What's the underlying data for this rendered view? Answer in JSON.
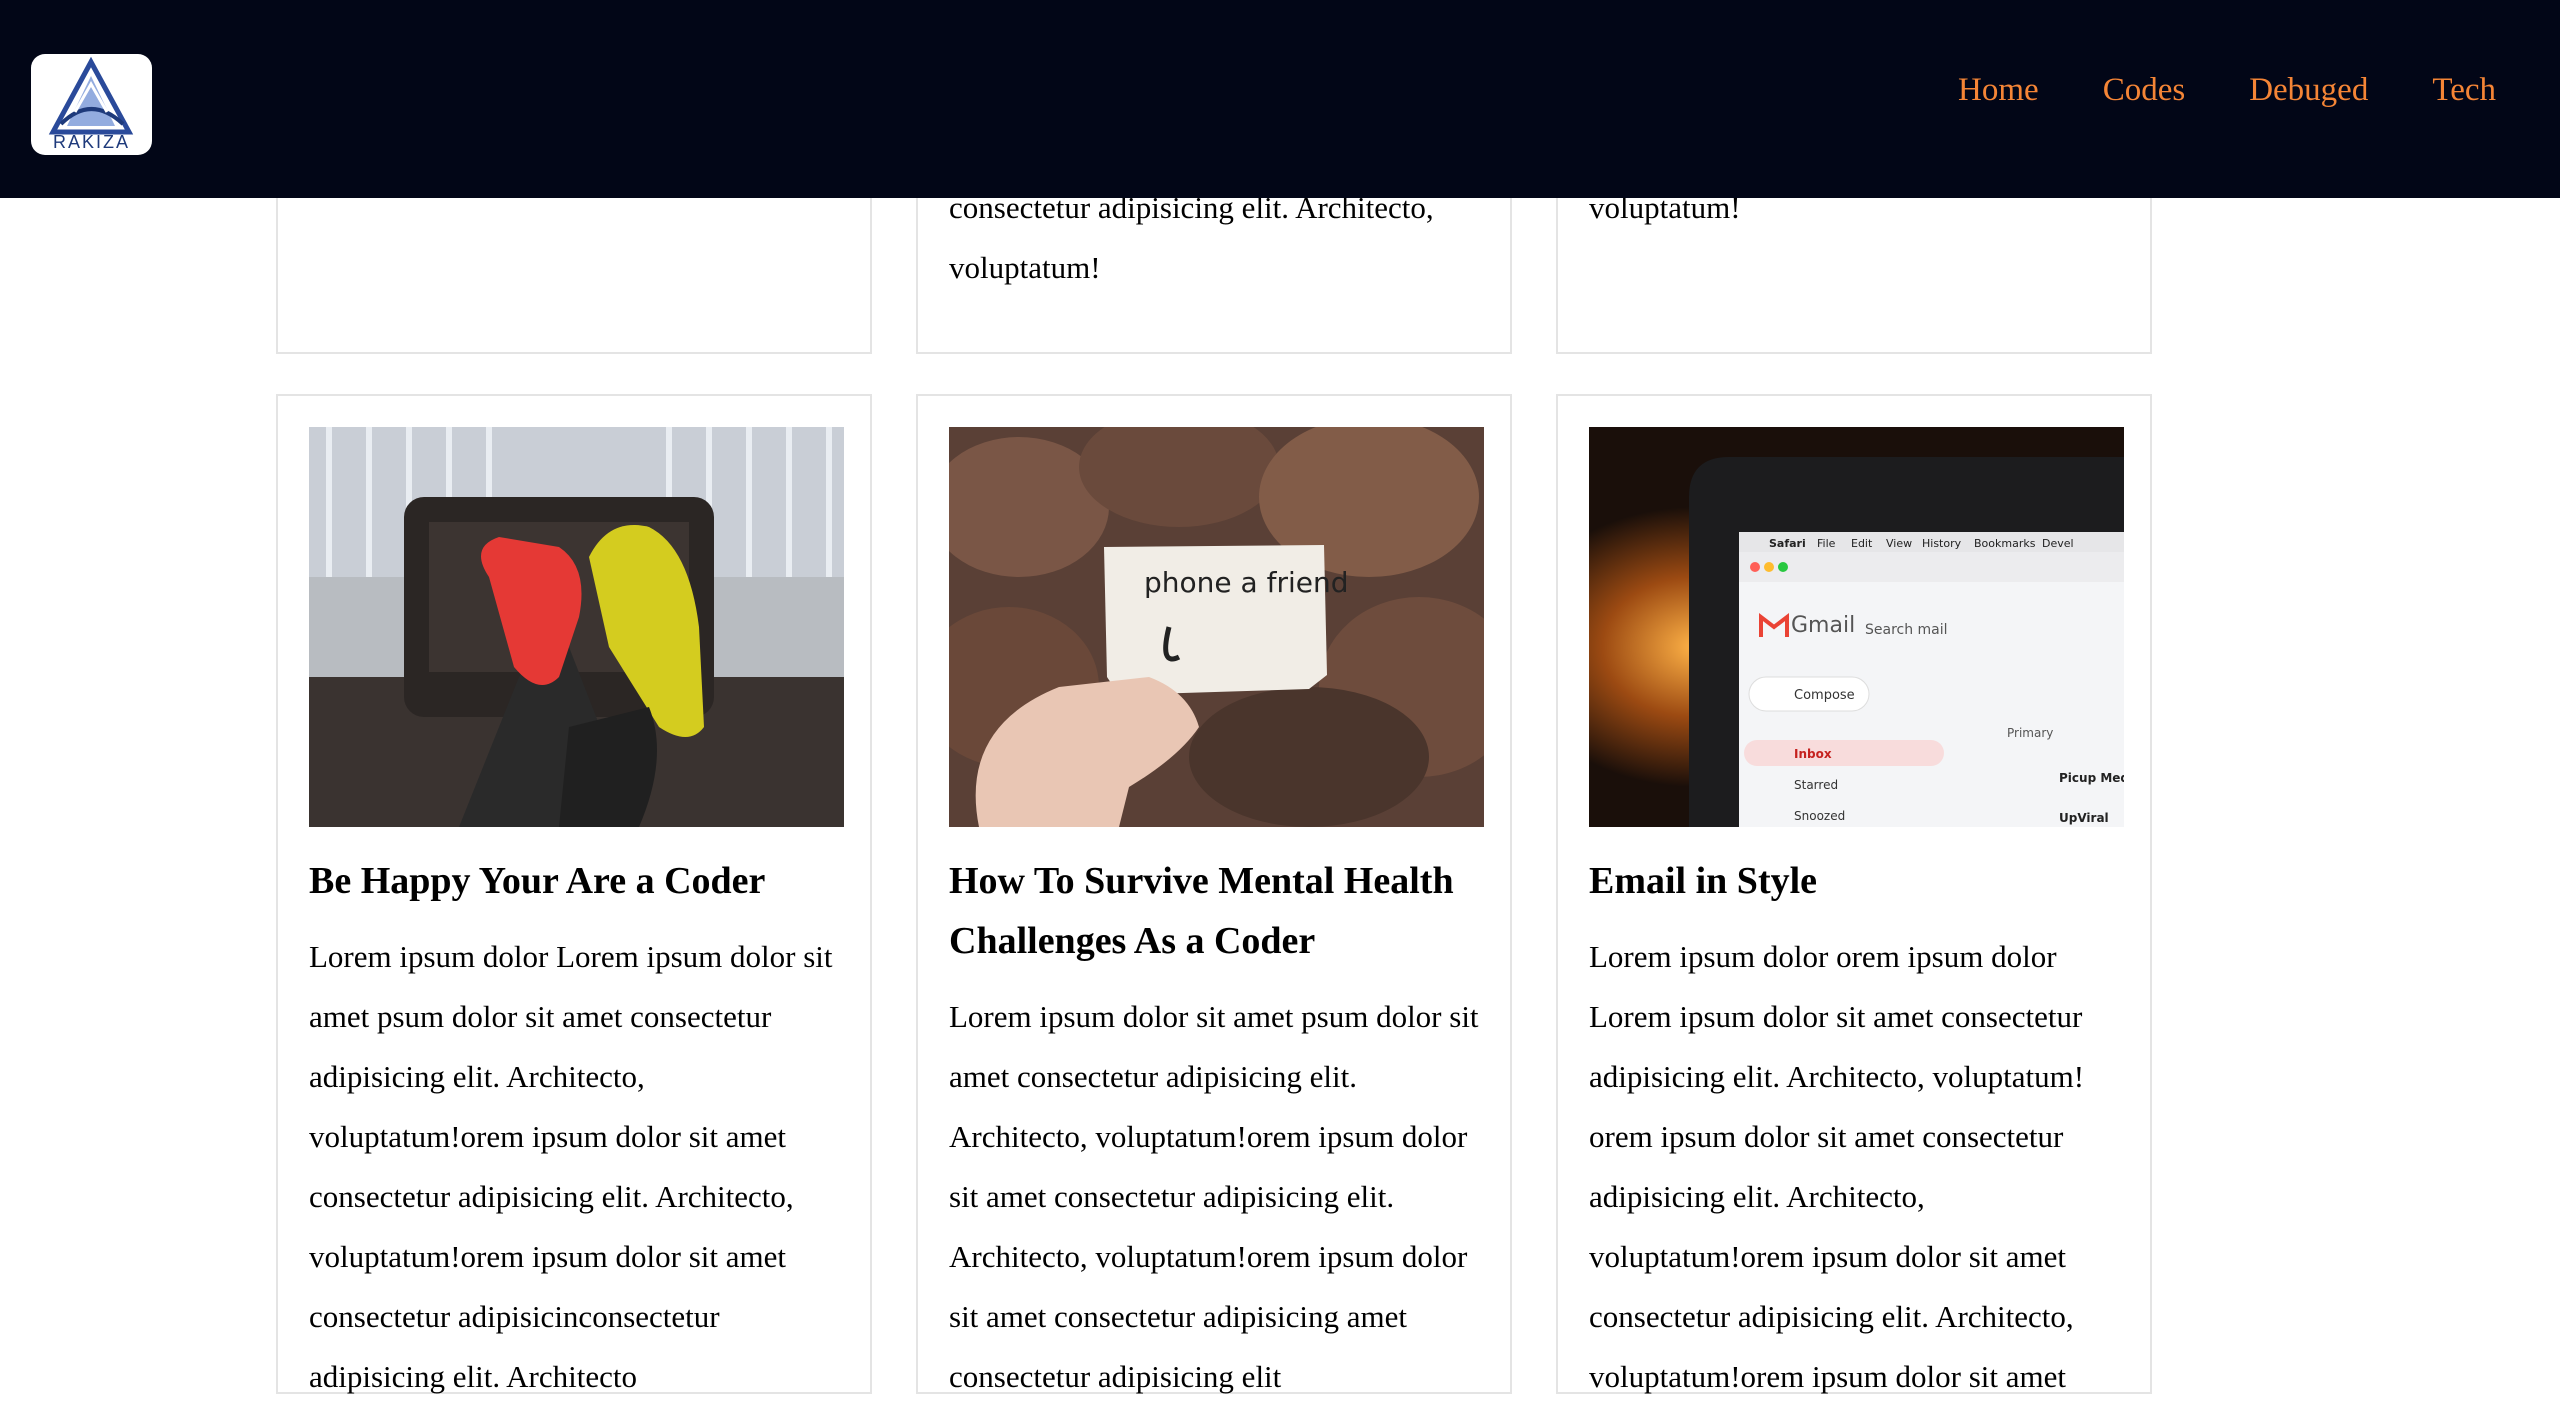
{
  "brand": {
    "logo_text": "RAKIZA",
    "accent_color": "#f58536",
    "header_color": "#020617"
  },
  "nav": {
    "items": [
      {
        "label": "Home"
      },
      {
        "label": "Codes"
      },
      {
        "label": "Debuged"
      },
      {
        "label": "Tech"
      }
    ]
  },
  "top_row": {
    "cards": [
      {
        "text": ""
      },
      {
        "text": "consectetur adipisicing elit. Architecto, voluptatum!"
      },
      {
        "text": "voluptatum!"
      }
    ]
  },
  "posts": [
    {
      "image": "sneakers-on-chair-photo",
      "title": "Be Happy Your Are a Coder",
      "body": "Lorem ipsum dolor Lorem ipsum dolor sit amet psum dolor sit amet consectetur adipisicing elit. Architecto, voluptatum!orem ipsum dolor sit amet consectetur adipisicing elit. Architecto, voluptatum!orem ipsum dolor sit amet consectetur adipisicinconsectetur adipisicing elit. Architecto"
    },
    {
      "image": "phone-a-friend-note-photo",
      "note_text": "phone a friend",
      "title": "How To Survive Mental Health Challenges As a Coder",
      "body": "Lorem ipsum dolor sit amet psum dolor sit amet consectetur adipisicing elit. Architecto, voluptatum!orem ipsum dolor sit amet consectetur adipisicing elit. Architecto, voluptatum!orem ipsum dolor sit amet consectetur adipisicing amet consectetur adipisicing elit"
    },
    {
      "image": "laptop-gmail-photo",
      "screen": {
        "menu": [
          "Safari",
          "File",
          "Edit",
          "View",
          "History",
          "Bookmarks",
          "Devel"
        ],
        "app": "Gmail",
        "search": "Search mail",
        "compose": "Compose",
        "primary": "Primary",
        "folders": [
          "Inbox",
          "Starred",
          "Snoozed"
        ],
        "senders": [
          "Picup Medi",
          "UpViral"
        ]
      },
      "title": "Email in Style",
      "body": "Lorem ipsum dolor orem ipsum dolor Lorem ipsum dolor sit amet consectetur adipisicing elit. Architecto, voluptatum! orem ipsum dolor sit amet consectetur adipisicing elit. Architecto, voluptatum!orem ipsum dolor sit amet consectetur adipisicing elit. Architecto, voluptatum!orem ipsum dolor sit amet"
    }
  ]
}
